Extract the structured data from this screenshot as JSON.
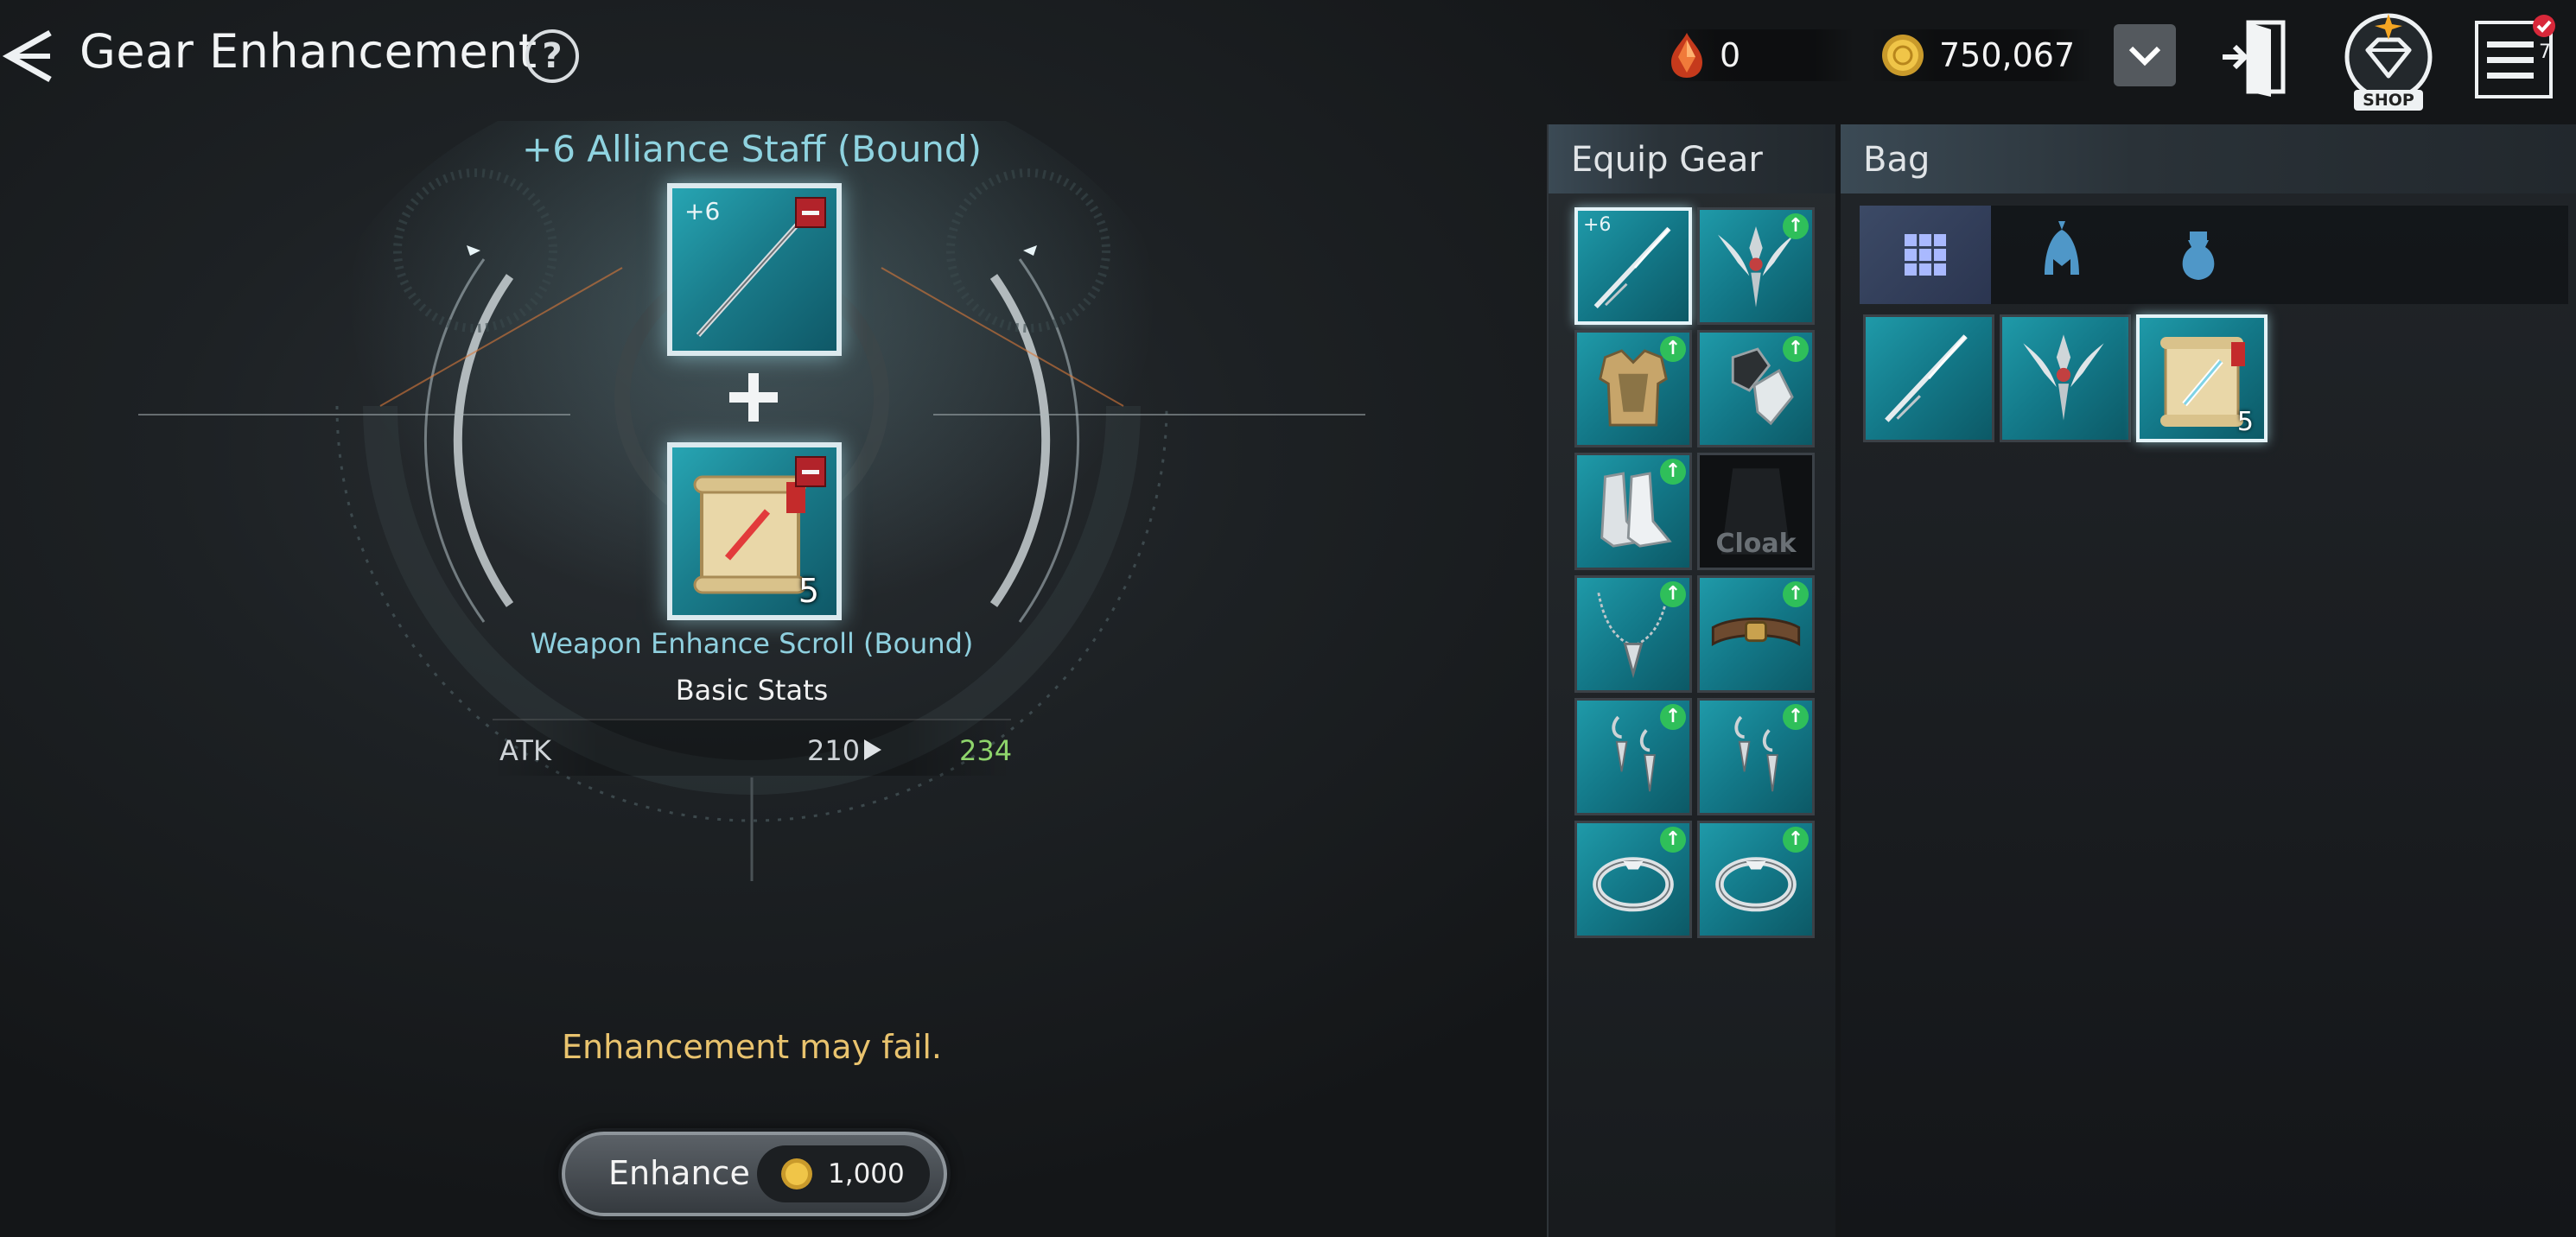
{
  "header": {
    "title": "Gear Enhancement",
    "help_symbol": "?",
    "gem_amount": "0",
    "gold_amount": "750,067",
    "shop_label": "SHOP",
    "notification_count": "7"
  },
  "enhance": {
    "item_title": "+6 Alliance Staff (Bound)",
    "main_slot_level": "+6",
    "scroll_count": "5",
    "scroll_name": "Weapon Enhance Scroll (Bound)",
    "basic_stats_label": "Basic Stats",
    "stat": {
      "name": "ATK",
      "current": "210",
      "next": "234"
    },
    "warning": "Enhancement may fail.",
    "button_label": "Enhance",
    "cost": "1,000"
  },
  "equip_panel": {
    "title": "Equip Gear",
    "slots": [
      {
        "name": "staff",
        "level": "+6",
        "upgradable": false,
        "selected": true
      },
      {
        "name": "shoulder-emblem",
        "upgradable": true
      },
      {
        "name": "chest-armor",
        "upgradable": true
      },
      {
        "name": "gloves",
        "upgradable": true
      },
      {
        "name": "boots",
        "upgradable": true
      },
      {
        "name": "cloak",
        "label": "Cloak",
        "empty": true
      },
      {
        "name": "necklace",
        "upgradable": true
      },
      {
        "name": "belt",
        "upgradable": true
      },
      {
        "name": "earring-left",
        "upgradable": true
      },
      {
        "name": "earring-right",
        "upgradable": true
      },
      {
        "name": "ring-left",
        "upgradable": true
      },
      {
        "name": "ring-right",
        "upgradable": true
      }
    ],
    "up_symbol": "↑"
  },
  "bag_panel": {
    "title": "Bag",
    "tabs": [
      "all-items",
      "equipment",
      "materials"
    ],
    "items": [
      {
        "name": "staff"
      },
      {
        "name": "shoulder-emblem"
      },
      {
        "name": "weapon-enhance-scroll",
        "count": "5",
        "selected": true
      }
    ]
  },
  "colors": {
    "accent_cyan": "#8fd3e0",
    "stat_increase": "#8ed46b",
    "warning": "#e9c36e",
    "slot_teal": "#1a8a9a"
  }
}
